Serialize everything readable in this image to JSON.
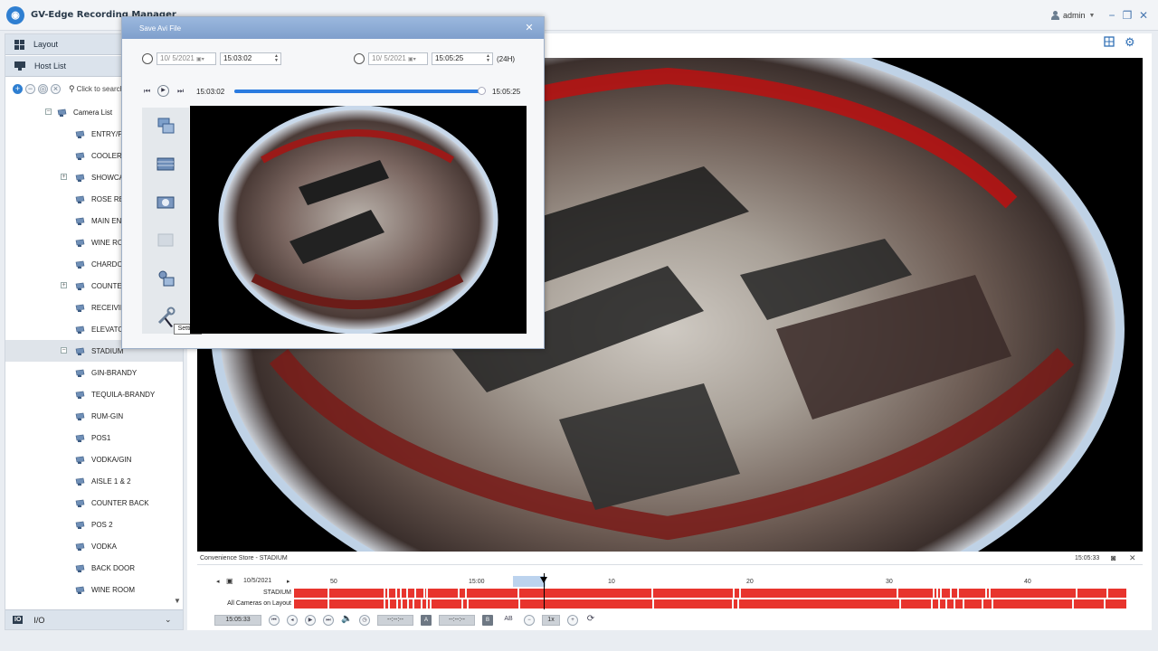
{
  "app": {
    "title": "GV-Edge Recording Manager",
    "user": "admin"
  },
  "sidebar": {
    "layout_label": "Layout",
    "hostlist_label": "Host List",
    "search_placeholder": "Click to search",
    "camera_list_label": "Camera List",
    "cameras": [
      {
        "label": "ENTRY/POS",
        "expandable": false,
        "selected": false
      },
      {
        "label": "COOLER",
        "expandable": false,
        "selected": false
      },
      {
        "label": "SHOWCASE",
        "expandable": true,
        "selected": false
      },
      {
        "label": "ROSE RED",
        "expandable": false,
        "selected": false
      },
      {
        "label": "MAIN EN",
        "expandable": false,
        "selected": false
      },
      {
        "label": "WINE RO",
        "expandable": false,
        "selected": false
      },
      {
        "label": "CHARDO",
        "expandable": false,
        "selected": false
      },
      {
        "label": "COUNTER",
        "expandable": true,
        "selected": false
      },
      {
        "label": "RECEIVIN",
        "expandable": false,
        "selected": false
      },
      {
        "label": "ELEVATOR",
        "expandable": false,
        "selected": false
      },
      {
        "label": "STADIUM",
        "expandable": true,
        "selected": true
      },
      {
        "label": "GIN-BRANDY",
        "expandable": false,
        "selected": false
      },
      {
        "label": "TEQUILA-BRANDY",
        "expandable": false,
        "selected": false
      },
      {
        "label": "RUM-GIN",
        "expandable": false,
        "selected": false
      },
      {
        "label": "POS1",
        "expandable": false,
        "selected": false
      },
      {
        "label": "VODKA/GIN",
        "expandable": false,
        "selected": false
      },
      {
        "label": "AISLE 1 & 2",
        "expandable": false,
        "selected": false
      },
      {
        "label": "COUNTER BACK",
        "expandable": false,
        "selected": false
      },
      {
        "label": "POS 2",
        "expandable": false,
        "selected": false
      },
      {
        "label": "VODKA",
        "expandable": false,
        "selected": false
      },
      {
        "label": "BACK DOOR",
        "expandable": false,
        "selected": false
      },
      {
        "label": "WINE ROOM",
        "expandable": false,
        "selected": false
      }
    ],
    "io_label": "I/O"
  },
  "dialog": {
    "title": "Save Avi File",
    "start_date": "10/ 5/2021",
    "start_time": "15:03:02",
    "end_date": "10/ 5/2021",
    "end_time": "15:05:25",
    "format": "(24H)",
    "play_start": "15:03:02",
    "play_end": "15:05:25",
    "progress": 0.99,
    "tooltip": "Setting"
  },
  "video": {
    "caption": "Convenience Store - STADIUM",
    "time": "15:05:33"
  },
  "timeline": {
    "date": "10/5/2021",
    "ruler_labels": [
      "50",
      "15:00",
      "10",
      "20",
      "30",
      "40"
    ],
    "track1_label": "STADIUM",
    "track2_label": "All Cameras on Layout",
    "current_time": "15:05:33",
    "marker_a": "A",
    "marker_b": "B",
    "ab_label": "AB",
    "speed": "1x",
    "blank_time": "--:--:--"
  },
  "colors": {
    "accent": "#2a7be0",
    "timeline_red": "#e8342d",
    "title_bar_blue": "#8aa9d4"
  }
}
